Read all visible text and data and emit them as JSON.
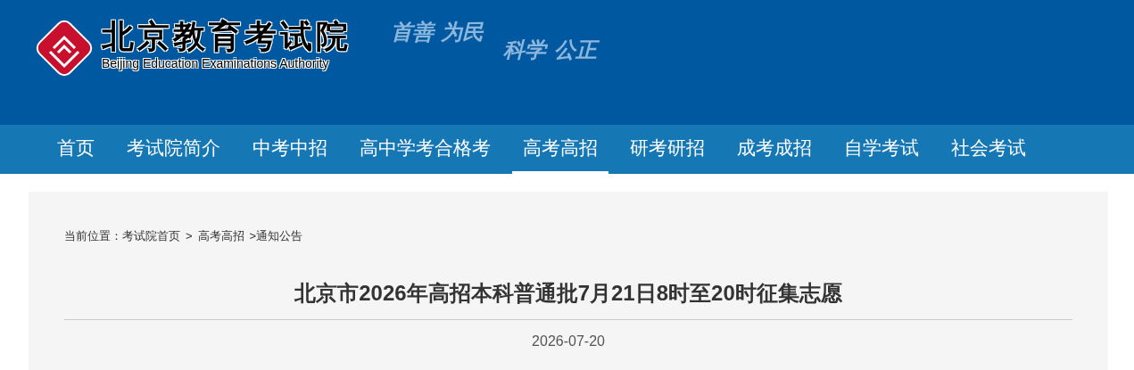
{
  "header": {
    "title": "北京教育考试院",
    "subtitle": "Beijing Education Examinations Authority",
    "slogans": [
      "首善 为民",
      "科学 公正"
    ]
  },
  "nav": {
    "items": [
      {
        "label": "首页",
        "selected": false
      },
      {
        "label": "考试院简介",
        "selected": false
      },
      {
        "label": "中考中招",
        "selected": false
      },
      {
        "label": "高中学考合格考",
        "selected": false
      },
      {
        "label": "高考高招",
        "selected": true
      },
      {
        "label": "研考研招",
        "selected": false
      },
      {
        "label": "成考成招",
        "selected": false
      },
      {
        "label": "自学考试",
        "selected": false
      },
      {
        "label": "社会考试",
        "selected": false
      }
    ]
  },
  "breadcrumb": {
    "prefix": "当前位置：",
    "separator": ">",
    "items": [
      "考试院首页",
      "高考高招",
      "通知公告"
    ]
  },
  "article": {
    "title": "北京市2026年高招本科普通批7月21日8时至20时征集志愿",
    "date": "2026-07-20"
  }
}
